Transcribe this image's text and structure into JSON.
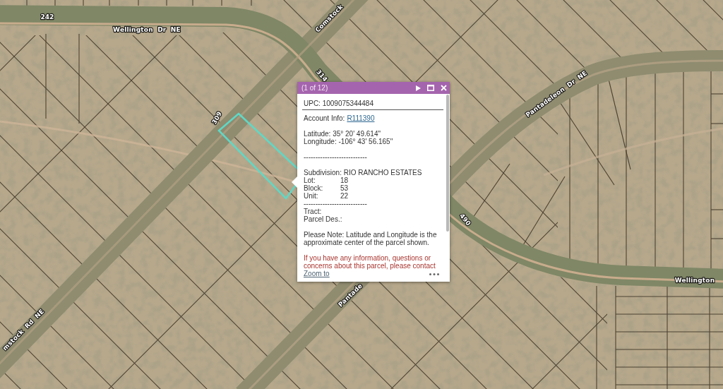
{
  "map": {
    "road_labels": [
      "Wellington Dr NE",
      "Comstock",
      "Pantadeleon Dr NE",
      "Wellington",
      "mstock Rd NE",
      "Pantade"
    ],
    "address_numbers": [
      "242",
      "314",
      "309",
      "490"
    ]
  },
  "popup": {
    "title": "(1 of 12)",
    "sections": [
      {
        "lines": [
          {
            "kind": "heading",
            "text": "UPC: 1009075344484"
          },
          {
            "kind": "link",
            "label": "Account Info:",
            "link": "R111390"
          }
        ]
      },
      {
        "lines": [
          {
            "kind": "text",
            "text": "Latitude: 35° 20' 49.614\""
          },
          {
            "kind": "text",
            "text": "Longitude: -106° 43' 56.165\""
          }
        ]
      },
      {
        "lines": [
          {
            "kind": "text",
            "text": "---------------------------"
          }
        ]
      },
      {
        "lines": [
          {
            "kind": "text",
            "text": "Subdivision: RIO RANCHO ESTATES"
          },
          {
            "kind": "field",
            "label": "Lot:",
            "value": "18"
          },
          {
            "kind": "field",
            "label": "Block:",
            "value": "53"
          },
          {
            "kind": "field",
            "label": "Unit:",
            "value": "22"
          },
          {
            "kind": "text",
            "text": "---------------------------"
          },
          {
            "kind": "text",
            "text": "Tract:"
          },
          {
            "kind": "text",
            "text": "Parcel Des.:"
          }
        ]
      },
      {
        "lines": [
          {
            "kind": "note",
            "text": "Please Note: Latitude and Longitude is the approximate center of the parcel shown."
          }
        ]
      },
      {
        "lines": [
          {
            "kind": "warning",
            "text": "If you have any information, questions or\nconcerns about this parcel, please contact"
          }
        ]
      }
    ],
    "footer_link": "Zoom to"
  }
}
